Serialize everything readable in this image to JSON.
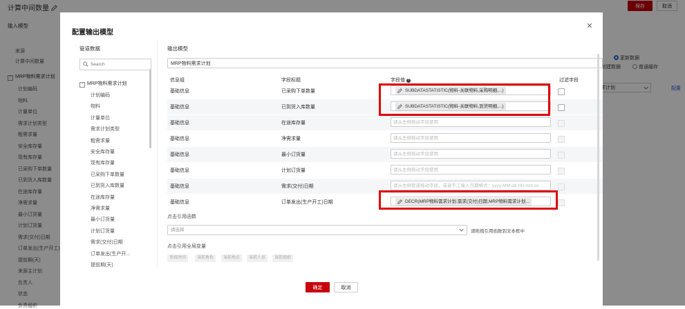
{
  "app": {
    "title": "计算中间数量",
    "save_label": "保存",
    "cancel_label": "取消"
  },
  "background_left": {
    "section_title": "输入模型",
    "items": [
      "来源",
      "计算中间数量"
    ],
    "tree_root": "MRP物料需求计划",
    "tree_items": [
      "计划编码",
      "物料",
      "计量单位",
      "需求计划类型",
      "粗需求量",
      "安全库存量",
      "现有库存量",
      "已采购下单数量",
      "已到货入库数量",
      "在途库存量",
      "净需求量",
      "最小订货量",
      "计划订货量",
      "需求(交付)日期",
      "订单发出(生产开工)",
      "提前期(天)",
      "来源主计划",
      "负责人",
      "状态",
      "负责组织"
    ]
  },
  "background_right": {
    "radio_on_label": "更新数据",
    "label_partial": "创建数据",
    "radio_off_label": "普通缓存",
    "select_value": "求计划",
    "link": "配置"
  },
  "dialog": {
    "title": "配置输出模型",
    "left_panel": {
      "title": "管道数据",
      "search_placeholder": "Search",
      "tree_root": "MRP物料需求计划",
      "tree_items": [
        "计划编码",
        "物料",
        "计量单位",
        "需求计划类型",
        "粗需求量",
        "安全库存量",
        "现有库存量",
        "已采购下单数量",
        "已到货入库数量",
        "在途库存量",
        "净需求量",
        "最小订货量",
        "计划订货量",
        "需求(交付)日期",
        "订单发出(生产开...",
        "提前期(天)"
      ]
    },
    "right_panel": {
      "title": "输出模型",
      "model_name": "MRP物料需求计划",
      "columns": [
        "信息组",
        "字段标题",
        "字段值",
        "过滤字段"
      ],
      "rows": [
        {
          "group": "基础信息",
          "field": "已采购下单数量",
          "value": "SUBDATASTATISTIC(物料-关联物料,采购明细,...)",
          "placeholder": ""
        },
        {
          "group": "基础信息",
          "field": "已到货入库数量",
          "value": "SUBDATASTATISTIC(物料-关联物料,到货明细,...)",
          "placeholder": ""
        },
        {
          "group": "基础信息",
          "field": "在途库存量",
          "value": "",
          "placeholder": "请从左侧拖动字段使用"
        },
        {
          "group": "基础信息",
          "field": "净需求量",
          "value": "",
          "placeholder": "请从左侧拖动字段使用"
        },
        {
          "group": "基础信息",
          "field": "最小订货量",
          "value": "",
          "placeholder": "请从左侧拖动字段使用"
        },
        {
          "group": "基础信息",
          "field": "计划订货量",
          "value": "",
          "placeholder": "请从左侧拖动字段使用"
        },
        {
          "group": "基础信息",
          "field": "需求(交付)日期",
          "value": "",
          "placeholder": "请从左侧管道拖动字段，或者手工输入日期格式：yyyy-MM-dd HH:mm:ss"
        },
        {
          "group": "基础信息",
          "field": "订单发出(生产开工)日期",
          "value": "DECR(MRP物料需求计划.需求(交付)日期,MRP物料需求计划...",
          "placeholder": ""
        }
      ],
      "func_section_label": "点击引用函数",
      "func_placeholder": "请选择",
      "func_hint": "请拖拽引用函数到文本框中",
      "global_section_label": "点击引用全局变量",
      "global_tags": [
        "系统时间",
        "当前角色",
        "当前地点",
        "当前人员",
        "当前组织"
      ]
    },
    "ok_label": "确定",
    "cancel_label": "取消"
  }
}
